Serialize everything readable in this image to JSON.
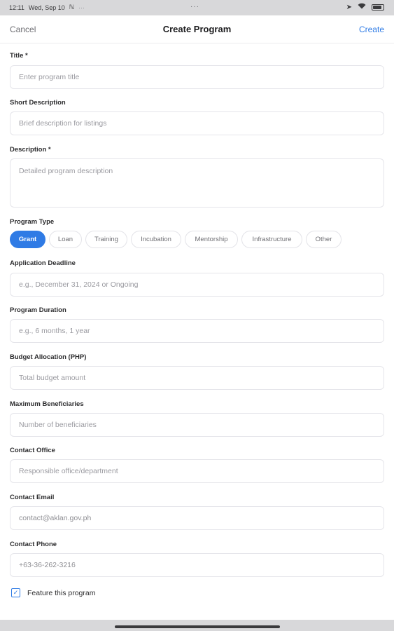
{
  "status_bar": {
    "time": "12:11",
    "date": "Wed, Sep 10",
    "icons": [
      "nfc-icon",
      "more-dots-icon",
      "location-icon",
      "wifi-icon",
      "battery-icon"
    ],
    "dots": "···"
  },
  "nav": {
    "cancel_label": "Cancel",
    "title": "Create Program",
    "create_label": "Create"
  },
  "form": {
    "title": {
      "label": "Title *",
      "placeholder": "Enter program title"
    },
    "short_description": {
      "label": "Short Description",
      "placeholder": "Brief description for listings"
    },
    "description": {
      "label": "Description *",
      "placeholder": "Detailed program description"
    },
    "program_type": {
      "label": "Program Type",
      "options": [
        "Grant",
        "Loan",
        "Training",
        "Incubation",
        "Mentorship",
        "Infrastructure",
        "Other"
      ],
      "selected": "Grant"
    },
    "application_deadline": {
      "label": "Application Deadline",
      "placeholder": "e.g., December 31, 2024 or Ongoing"
    },
    "program_duration": {
      "label": "Program Duration",
      "placeholder": "e.g., 6 months, 1 year"
    },
    "budget_allocation": {
      "label": "Budget Allocation (PHP)",
      "placeholder": "Total budget amount"
    },
    "maximum_beneficiaries": {
      "label": "Maximum Beneficiaries",
      "placeholder": "Number of beneficiaries"
    },
    "contact_office": {
      "label": "Contact Office",
      "placeholder": "Responsible office/department"
    },
    "contact_email": {
      "label": "Contact Email",
      "value": "contact@aklan.gov.ph"
    },
    "contact_phone": {
      "label": "Contact Phone",
      "value": "+63-36-262-3216"
    },
    "feature": {
      "label": "Feature this program",
      "checked": true
    }
  },
  "colors": {
    "accent": "#2f7be5",
    "border": "#e5e5ea",
    "status_bar_bg": "#d8d8da"
  }
}
